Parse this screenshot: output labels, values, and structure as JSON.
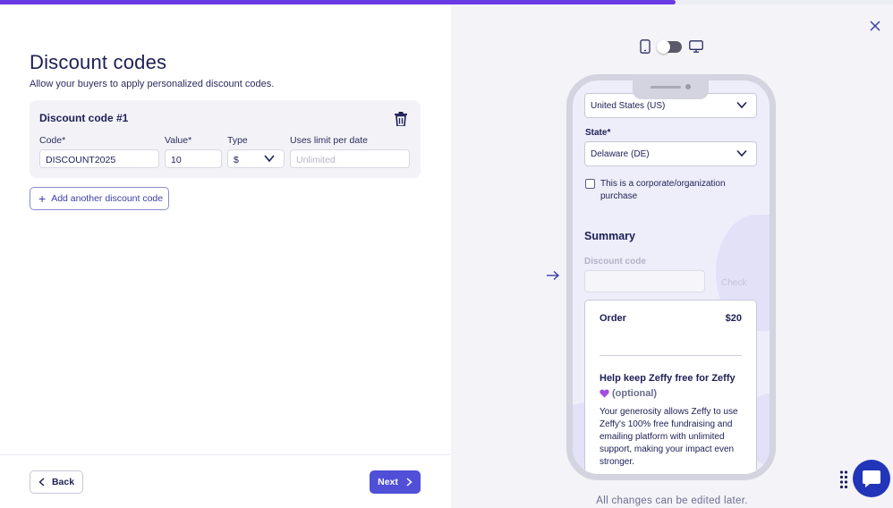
{
  "progress": {
    "fraction": 0.757
  },
  "page": {
    "title": "Discount codes",
    "subtitle": "Allow your buyers to apply personalized discount codes."
  },
  "discount_card": {
    "title": "Discount code #1",
    "code_label": "Code*",
    "code_value": "DISCOUNT2025",
    "value_label": "Value*",
    "value_value": "10",
    "type_label": "Type",
    "type_value": "$",
    "uses_label": "Uses limit per date",
    "uses_placeholder": "Unlimited"
  },
  "add_button": {
    "label": "Add another discount code"
  },
  "footer": {
    "back_label": "Back",
    "next_label": "Next"
  },
  "preview": {
    "country_value": "United States (US)",
    "state_label": "State*",
    "state_value": "Delaware (DE)",
    "corporate_label": "This is a corporate/organization purchase",
    "summary_title": "Summary",
    "discount_label": "Discount code",
    "check_label": "Check",
    "order_label": "Order",
    "order_amount": "$20",
    "help_title": "Help keep Zeffy free for Zeffy",
    "optional_label": "(optional)",
    "help_body": "Your generosity allows Zeffy to use Zeffy's 100% free fundraising and emailing platform with unlimited support, making your impact even stronger."
  },
  "bottom_note": "All changes can be edited later.",
  "colors": {
    "accent": "#4f4fd8",
    "progress": "#6a3be4",
    "chat": "#2235b8",
    "heart": "#a34ddf"
  }
}
